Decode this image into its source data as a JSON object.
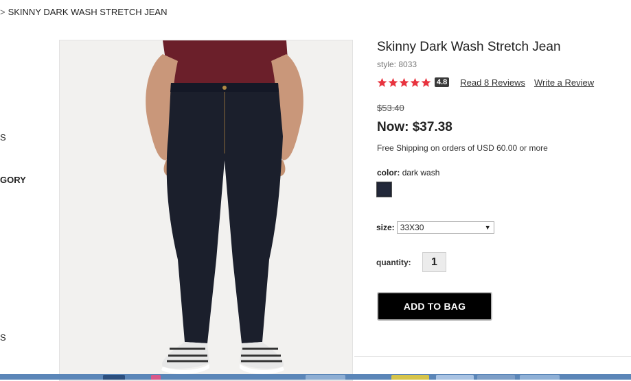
{
  "breadcrumb": {
    "separator": ">",
    "current": "SKINNY DARK WASH STRETCH JEAN"
  },
  "sidebar": {
    "fragment_1": "S",
    "fragment_2": "GORY",
    "fragment_3": "S"
  },
  "product": {
    "title": "Skinny Dark Wash Stretch Jean",
    "style": "style: 8033",
    "rating": {
      "stars": 5,
      "value": "4.8",
      "star_color": "#e8343f"
    },
    "read_reviews": "Read 8 Reviews",
    "write_review": "Write a Review",
    "original_price": "$53.40",
    "sale_price": "Now: $37.38",
    "shipping": "Free Shipping on orders of USD 60.00 or more",
    "color_label": "color:",
    "color_value": "dark wash",
    "swatch_color": "#1f2533",
    "size_label": "size:",
    "size_value": "33X30",
    "quantity_label": "quantity:",
    "quantity_value": "1",
    "add_to_bag": "ADD TO BAG"
  },
  "colors": {
    "taskbar": "#5b86b8",
    "button_bg": "#000000"
  }
}
